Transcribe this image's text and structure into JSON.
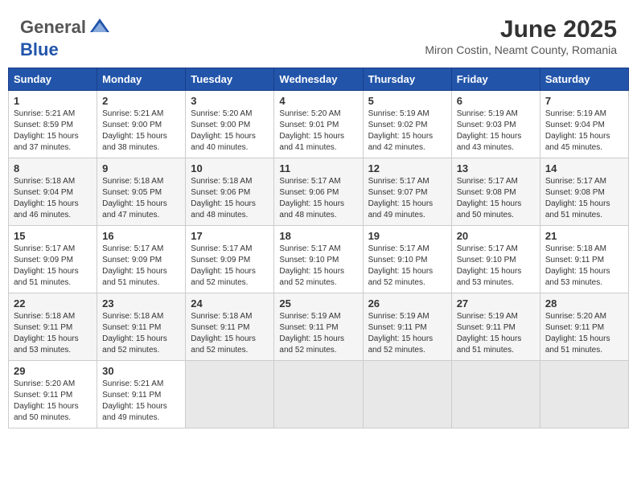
{
  "header": {
    "logo_line1": "General",
    "logo_line2": "Blue",
    "month": "June 2025",
    "location": "Miron Costin, Neamt County, Romania"
  },
  "weekdays": [
    "Sunday",
    "Monday",
    "Tuesday",
    "Wednesday",
    "Thursday",
    "Friday",
    "Saturday"
  ],
  "weeks": [
    [
      {
        "day": "1",
        "sunrise": "5:21 AM",
        "sunset": "8:59 PM",
        "daylight": "15 hours and 37 minutes."
      },
      {
        "day": "2",
        "sunrise": "5:21 AM",
        "sunset": "9:00 PM",
        "daylight": "15 hours and 38 minutes."
      },
      {
        "day": "3",
        "sunrise": "5:20 AM",
        "sunset": "9:00 PM",
        "daylight": "15 hours and 40 minutes."
      },
      {
        "day": "4",
        "sunrise": "5:20 AM",
        "sunset": "9:01 PM",
        "daylight": "15 hours and 41 minutes."
      },
      {
        "day": "5",
        "sunrise": "5:19 AM",
        "sunset": "9:02 PM",
        "daylight": "15 hours and 42 minutes."
      },
      {
        "day": "6",
        "sunrise": "5:19 AM",
        "sunset": "9:03 PM",
        "daylight": "15 hours and 43 minutes."
      },
      {
        "day": "7",
        "sunrise": "5:19 AM",
        "sunset": "9:04 PM",
        "daylight": "15 hours and 45 minutes."
      }
    ],
    [
      {
        "day": "8",
        "sunrise": "5:18 AM",
        "sunset": "9:04 PM",
        "daylight": "15 hours and 46 minutes."
      },
      {
        "day": "9",
        "sunrise": "5:18 AM",
        "sunset": "9:05 PM",
        "daylight": "15 hours and 47 minutes."
      },
      {
        "day": "10",
        "sunrise": "5:18 AM",
        "sunset": "9:06 PM",
        "daylight": "15 hours and 48 minutes."
      },
      {
        "day": "11",
        "sunrise": "5:17 AM",
        "sunset": "9:06 PM",
        "daylight": "15 hours and 48 minutes."
      },
      {
        "day": "12",
        "sunrise": "5:17 AM",
        "sunset": "9:07 PM",
        "daylight": "15 hours and 49 minutes."
      },
      {
        "day": "13",
        "sunrise": "5:17 AM",
        "sunset": "9:08 PM",
        "daylight": "15 hours and 50 minutes."
      },
      {
        "day": "14",
        "sunrise": "5:17 AM",
        "sunset": "9:08 PM",
        "daylight": "15 hours and 51 minutes."
      }
    ],
    [
      {
        "day": "15",
        "sunrise": "5:17 AM",
        "sunset": "9:09 PM",
        "daylight": "15 hours and 51 minutes."
      },
      {
        "day": "16",
        "sunrise": "5:17 AM",
        "sunset": "9:09 PM",
        "daylight": "15 hours and 51 minutes."
      },
      {
        "day": "17",
        "sunrise": "5:17 AM",
        "sunset": "9:09 PM",
        "daylight": "15 hours and 52 minutes."
      },
      {
        "day": "18",
        "sunrise": "5:17 AM",
        "sunset": "9:10 PM",
        "daylight": "15 hours and 52 minutes."
      },
      {
        "day": "19",
        "sunrise": "5:17 AM",
        "sunset": "9:10 PM",
        "daylight": "15 hours and 52 minutes."
      },
      {
        "day": "20",
        "sunrise": "5:17 AM",
        "sunset": "9:10 PM",
        "daylight": "15 hours and 53 minutes."
      },
      {
        "day": "21",
        "sunrise": "5:18 AM",
        "sunset": "9:11 PM",
        "daylight": "15 hours and 53 minutes."
      }
    ],
    [
      {
        "day": "22",
        "sunrise": "5:18 AM",
        "sunset": "9:11 PM",
        "daylight": "15 hours and 53 minutes."
      },
      {
        "day": "23",
        "sunrise": "5:18 AM",
        "sunset": "9:11 PM",
        "daylight": "15 hours and 52 minutes."
      },
      {
        "day": "24",
        "sunrise": "5:18 AM",
        "sunset": "9:11 PM",
        "daylight": "15 hours and 52 minutes."
      },
      {
        "day": "25",
        "sunrise": "5:19 AM",
        "sunset": "9:11 PM",
        "daylight": "15 hours and 52 minutes."
      },
      {
        "day": "26",
        "sunrise": "5:19 AM",
        "sunset": "9:11 PM",
        "daylight": "15 hours and 52 minutes."
      },
      {
        "day": "27",
        "sunrise": "5:19 AM",
        "sunset": "9:11 PM",
        "daylight": "15 hours and 51 minutes."
      },
      {
        "day": "28",
        "sunrise": "5:20 AM",
        "sunset": "9:11 PM",
        "daylight": "15 hours and 51 minutes."
      }
    ],
    [
      {
        "day": "29",
        "sunrise": "5:20 AM",
        "sunset": "9:11 PM",
        "daylight": "15 hours and 50 minutes."
      },
      {
        "day": "30",
        "sunrise": "5:21 AM",
        "sunset": "9:11 PM",
        "daylight": "15 hours and 49 minutes."
      },
      null,
      null,
      null,
      null,
      null
    ]
  ],
  "labels": {
    "sunrise": "Sunrise:",
    "sunset": "Sunset:",
    "daylight": "Daylight:"
  }
}
